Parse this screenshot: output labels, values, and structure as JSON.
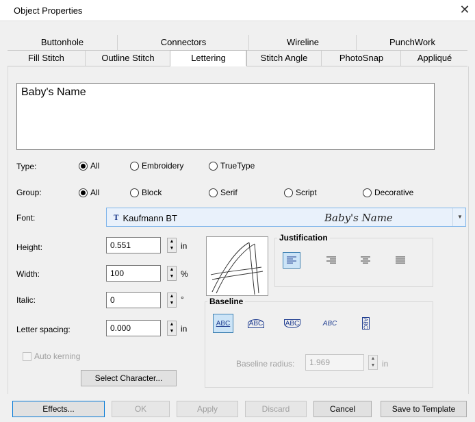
{
  "window": {
    "title": "Object Properties",
    "close_glyph": "✕"
  },
  "tabs_top": [
    "Buttonhole",
    "Connectors",
    "Wireline",
    "PunchWork"
  ],
  "tabs_bottom": [
    "Fill Stitch",
    "Outline Stitch",
    "Lettering",
    "Stitch Angle",
    "PhotoSnap",
    "Appliqué"
  ],
  "active_tab": "Lettering",
  "text_value": "Baby's Name",
  "type": {
    "label": "Type:",
    "options": [
      "All",
      "Embroidery",
      "TrueType"
    ],
    "selected": "All"
  },
  "group": {
    "label": "Group:",
    "options": [
      "All",
      "Block",
      "Serif",
      "Script",
      "Decorative"
    ],
    "selected": "All"
  },
  "font": {
    "label": "Font:",
    "value": "Kaufmann BT",
    "preview": "Baby's Name",
    "icon": "truetype-icon"
  },
  "fields": {
    "height": {
      "label": "Height:",
      "value": "0.551",
      "unit": "in"
    },
    "width": {
      "label": "Width:",
      "value": "100",
      "unit": "%"
    },
    "italic": {
      "label": "Italic:",
      "value": "0",
      "unit": "°"
    },
    "spacing": {
      "label": "Letter spacing:",
      "value": "0.000",
      "unit": "in"
    }
  },
  "justification": {
    "label": "Justification",
    "options": [
      "align-left-icon",
      "align-right-icon",
      "align-center-icon",
      "align-justify-icon"
    ],
    "selected": "align-left-icon"
  },
  "baseline": {
    "label": "Baseline",
    "options": [
      "ABC",
      "ABC",
      "ABC",
      "ABC",
      "ABC"
    ],
    "selected": 0,
    "radius_label": "Baseline radius:",
    "radius_value": "1.969",
    "radius_unit": "in"
  },
  "auto_kerning": {
    "label": "Auto kerning",
    "checked": false,
    "enabled": false
  },
  "select_character_label": "Select Character...",
  "buttons": {
    "effects": "Effects...",
    "ok": "OK",
    "apply": "Apply",
    "discard": "Discard",
    "cancel": "Cancel",
    "save_template": "Save to Template"
  },
  "colors": {
    "selected_bg": "#cce4f7",
    "selected_border": "#3c7fb1",
    "font_bg": "#e9f1fb"
  }
}
